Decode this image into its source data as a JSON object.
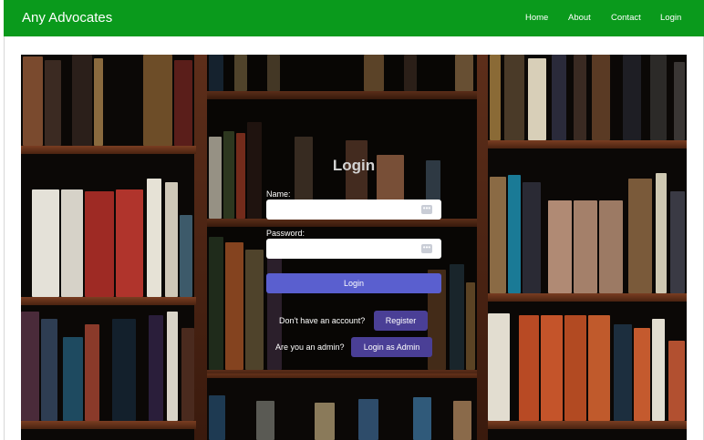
{
  "navbar": {
    "brand": "Any Advocates",
    "links": [
      "Home",
      "About",
      "Contact",
      "Login"
    ]
  },
  "form": {
    "title": "Login",
    "name_label": "Name:",
    "password_label": "Password:",
    "name_value": "",
    "password_value": "",
    "submit_label": "Login"
  },
  "register": {
    "prompt": "Don't have an account?",
    "button": "Register"
  },
  "admin": {
    "prompt": "Are you an admin?",
    "button": "Login as Admin"
  },
  "colors": {
    "navbar": "#0a9a1c",
    "primary_button": "#5a5fcf",
    "secondary_button": "#4a3f96"
  }
}
